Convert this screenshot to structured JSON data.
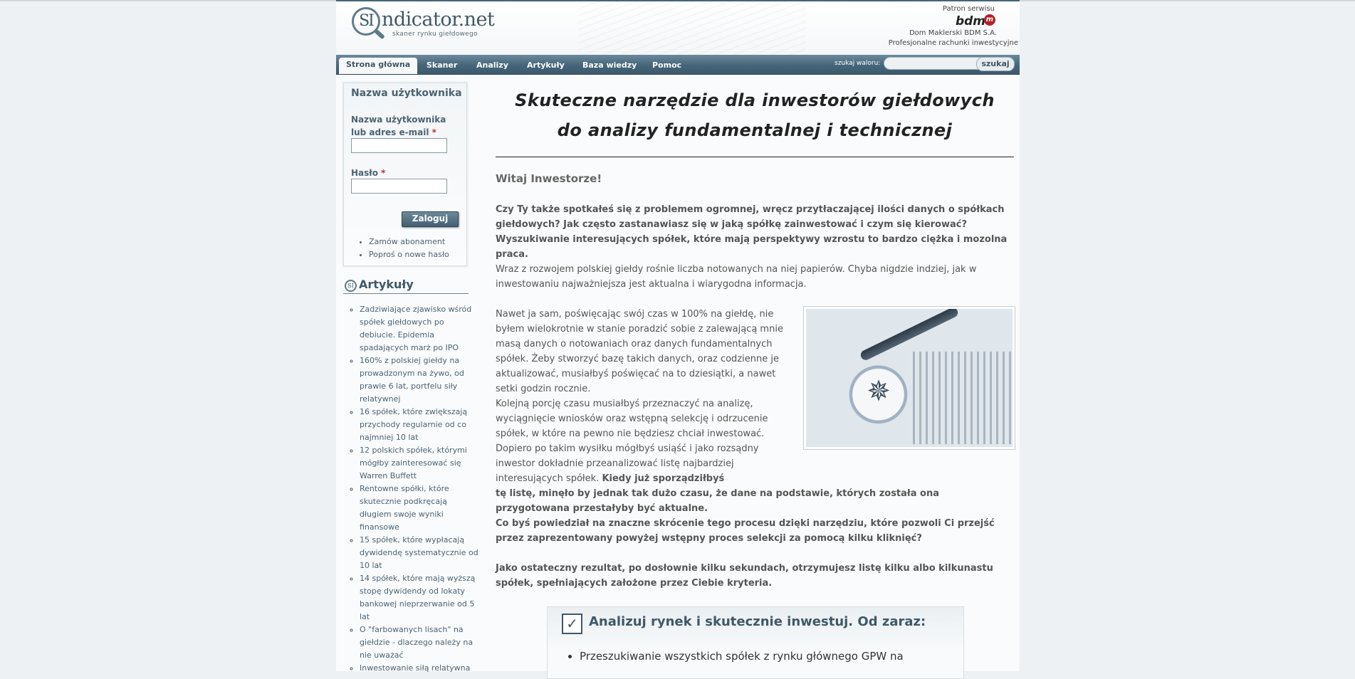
{
  "header": {
    "logo_main": "SIndicator.net",
    "logo_circle": "SI",
    "logo_rest": "ndicator.net",
    "logo_tagline": "skaner rynku giełdowego",
    "patron_label": "Patron serwisu",
    "patron_logo": "bdm",
    "patron_name": "Dom Maklerski BDM S.A.",
    "patron_desc": "Profesjonalne rachunki inwestycyjne"
  },
  "nav": {
    "items": [
      {
        "label": "Strona główna",
        "active": true
      },
      {
        "label": "Skaner"
      },
      {
        "label": "Analizy"
      },
      {
        "label": "Artykuły"
      },
      {
        "label": "Baza wiedzy"
      },
      {
        "label": "Pomoc"
      }
    ],
    "search_label": "szukaj waloru:",
    "search_value": "",
    "search_button": "szukaj"
  },
  "login": {
    "title": "Nazwa użytkownika",
    "username_label": "Nazwa użytkownika lub adres e-mail",
    "password_label": "Hasło",
    "required_mark": "*",
    "username_value": "",
    "password_value": "",
    "submit_label": "Zaloguj",
    "links": [
      "Zamów abonament",
      "Poproś o nowe hasło"
    ]
  },
  "articles": {
    "title": "Artykuły",
    "items": [
      "Zadziwiające zjawisko wśród spółek giełdowych po debiucie. Epidemia spadających marż po IPO",
      "160% z polskiej giełdy na prowadzonym na żywo, od prawie 6 lat, portfelu siły relatywnej",
      "16 spółek, które zwiększają przychody regularnie od co najmniej 10 lat",
      "12 polskich spółek, którymi mógłby zainteresować się Warren Buffett",
      "Rentowne spółki, które skutecznie podkręcają długiem swoje wyniki finansowe",
      "15 spółek, które wypłacają dywidendę systematycznie od 10 lat",
      "14 spółek, które mają wyższą stopę dywidendy od lokaty bankowej nieprzerwanie od 5 lat",
      "O \"farbowanych lisach\" na giełdzie - dlaczego należy na nie uważać",
      "Inwestowanie siłą relatywna"
    ]
  },
  "main": {
    "hero_line1": "Skuteczne narzędzie dla inwestorów giełdowych",
    "hero_line2": "do analizy fundamentalnej i technicznej",
    "welcome": "Witaj Inwestorze!",
    "p1": "Czy Ty także spotkałeś się z problemem ogromnej, wręcz przytłaczającej ilości danych o spółkach giełdowych? Jak często zastanawiasz się w jaką spółkę zainwestować i czym się kierować? Wyszukiwanie interesujących spółek, które mają perspektywy wzrostu to bardzo ciężka i mozolna praca.",
    "p2": "Wraz z rozwojem polskiej giełdy rośnie liczba notowanych na niej papierów. Chyba nigdzie indziej, jak w inwestowaniu najważniejsza jest aktualna i wiarygodna informacja.",
    "p3": "Nawet ja sam, poświęcając swój czas w 100% na giełdę, nie byłem wielokrotnie w stanie poradzić sobie z zalewającą mnie masą danych o notowaniach oraz danych fundamentalnych spółek. Żeby stworzyć bazę takich danych, oraz codzienne je aktualizować, musiałbyś poświęcać na to dziesiątki, a nawet setki godzin rocznie.",
    "p4_normal": "Kolejną porcję czasu musiałbyś przeznaczyć na analizę, wyciągnięcie wniosków oraz wstępną selekcję i odrzucenie spółek, w które na pewno nie będziesz chciał inwestować. Dopiero po takim wysiłku mógłbyś usiąść i jako rozsądny inwestor dokładnie przeanalizować listę najbardziej interesujących spółek.",
    "p4_bold_a": "Kiedy już sporządziłbyś",
    "p4_bold_b": "tę listę, minęło by jednak tak dużo czasu, że dane na podstawie, których została ona przygotowana przestałyby być aktualne.",
    "p5": "Co byś powiedział na znaczne skrócenie tego procesu dzięki narzędziu, które pozwoli Ci przejść przez zaprezentowany powyżej wstępny proces selekcji za pomocą kilku kliknięć?",
    "p6": "Jako ostateczny rezultat, po dosłownie kilku sekundach, otrzymujesz listę kilku albo kilkunastu spółek, spełniających założone przez Ciebie kryteria.",
    "cta_title": "Analizuj rynek i skutecznie inwestuj. Od zaraz:",
    "cta_item1": "Przeszukiwanie wszystkich spółek z rynku głównego GPW na"
  },
  "colors": {
    "nav": "#45657a",
    "accent": "#3f5868",
    "required": "#c62b2b",
    "patron": "#b52025"
  }
}
